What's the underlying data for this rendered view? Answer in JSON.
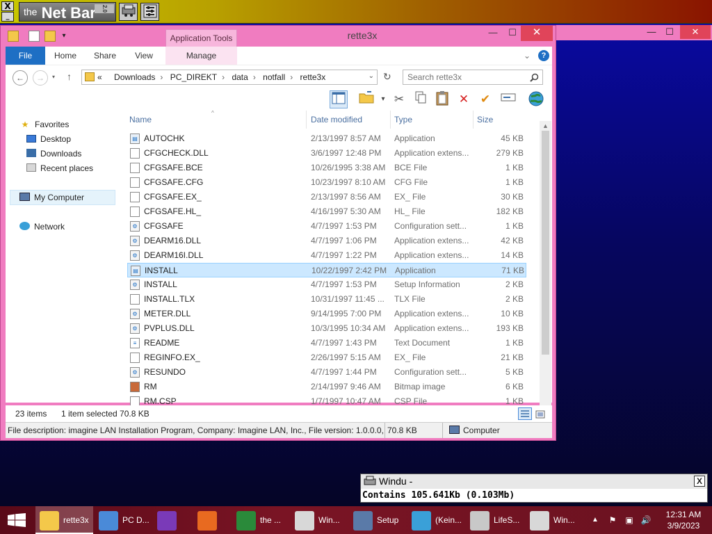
{
  "netbar": {
    "close_glyph": "X",
    "underscore_glyph": "_",
    "logo_prefix": "the",
    "logo_text": "Net Bar",
    "logo_version": "2.0",
    "apps": [
      "network-app-icon",
      "settings-app-icon"
    ]
  },
  "window": {
    "title": "rette3x",
    "context_tab": "Application Tools",
    "controls": {
      "minimize": "—",
      "maximize": "☐",
      "close": "✕"
    }
  },
  "ribbon": {
    "tabs": {
      "file": "File",
      "home": "Home",
      "share": "Share",
      "view": "View",
      "manage": "Manage"
    },
    "expand_glyph": "⌄",
    "help_glyph": "?"
  },
  "address": {
    "overflow": "«",
    "crumbs": [
      "Downloads",
      "PC_DIREKT",
      "data",
      "notfall",
      "rette3x"
    ],
    "search_placeholder": "Search rette3x"
  },
  "navpane": {
    "favorites": "Favorites",
    "desktop": "Desktop",
    "downloads": "Downloads",
    "recent": "Recent places",
    "mycomputer": "My Computer",
    "network": "Network"
  },
  "columns": {
    "name": "Name",
    "date": "Date modified",
    "type": "Type",
    "size": "Size"
  },
  "files": [
    {
      "name": "AUTOCHK",
      "date": "2/13/1997 8:57 AM",
      "type": "Application",
      "size": "45 KB",
      "icon": "app"
    },
    {
      "name": "CFGCHECK.DLL",
      "date": "3/6/1997 12:48 PM",
      "type": "Application extens...",
      "size": "279 KB",
      "icon": "file"
    },
    {
      "name": "CFGSAFE.BCE",
      "date": "10/26/1995 3:38 AM",
      "type": "BCE File",
      "size": "1 KB",
      "icon": "file"
    },
    {
      "name": "CFGSAFE.CFG",
      "date": "10/23/1997 8:10 AM",
      "type": "CFG File",
      "size": "1 KB",
      "icon": "file"
    },
    {
      "name": "CFGSAFE.EX_",
      "date": "2/13/1997 8:56 AM",
      "type": "EX_ File",
      "size": "30 KB",
      "icon": "file"
    },
    {
      "name": "CFGSAFE.HL_",
      "date": "4/16/1997 5:30 AM",
      "type": "HL_ File",
      "size": "182 KB",
      "icon": "file"
    },
    {
      "name": "CFGSAFE",
      "date": "4/7/1997 1:53 PM",
      "type": "Configuration sett...",
      "size": "1 KB",
      "icon": "gear"
    },
    {
      "name": "DEARM16.DLL",
      "date": "4/7/1997 1:06 PM",
      "type": "Application extens...",
      "size": "42 KB",
      "icon": "gear"
    },
    {
      "name": "DEARM16I.DLL",
      "date": "4/7/1997 1:22 PM",
      "type": "Application extens...",
      "size": "14 KB",
      "icon": "gear"
    },
    {
      "name": "INSTALL",
      "date": "10/22/1997 2:42 PM",
      "type": "Application",
      "size": "71 KB",
      "icon": "app"
    },
    {
      "name": "INSTALL",
      "date": "4/7/1997 1:53 PM",
      "type": "Setup Information",
      "size": "2 KB",
      "icon": "gear"
    },
    {
      "name": "INSTALL.TLX",
      "date": "10/31/1997 11:45 ...",
      "type": "TLX File",
      "size": "2 KB",
      "icon": "file"
    },
    {
      "name": "METER.DLL",
      "date": "9/14/1995 7:00 PM",
      "type": "Application extens...",
      "size": "10 KB",
      "icon": "gear"
    },
    {
      "name": "PVPLUS.DLL",
      "date": "10/3/1995 10:34 AM",
      "type": "Application extens...",
      "size": "193 KB",
      "icon": "gear"
    },
    {
      "name": "README",
      "date": "4/7/1997 1:43 PM",
      "type": "Text Document",
      "size": "1 KB",
      "icon": "text"
    },
    {
      "name": "REGINFO.EX_",
      "date": "2/26/1997 5:15 AM",
      "type": "EX_ File",
      "size": "21 KB",
      "icon": "file"
    },
    {
      "name": "RESUNDO",
      "date": "4/7/1997 1:44 PM",
      "type": "Configuration sett...",
      "size": "5 KB",
      "icon": "gear"
    },
    {
      "name": "RM",
      "date": "2/14/1997 9:46 AM",
      "type": "Bitmap image",
      "size": "6 KB",
      "icon": "bitmap"
    },
    {
      "name": "RM.CSP",
      "date": "1/7/1997 10:47 AM",
      "type": "CSP File",
      "size": "1 KB",
      "icon": "file"
    }
  ],
  "selected_index": 9,
  "status": {
    "count": "23 items",
    "selection": "1 item selected  70.8 KB",
    "description": "File description: imagine LAN Installation Program, Company: Imagine LAN, Inc., File version: 1.0.0.0, D",
    "size": "70.8 KB",
    "location": "Computer"
  },
  "popup": {
    "title": "Windu -",
    "body": "Contains 105.641Kb (0.103Mb)",
    "close_glyph": "X"
  },
  "taskbar": {
    "items": [
      {
        "label": "rette3x",
        "icon": "folder-icon"
      },
      {
        "label": "PC D...",
        "icon": "chrome-icon"
      },
      {
        "label": "",
        "icon": "visual-studio-icon"
      },
      {
        "label": "",
        "icon": "firefox-icon"
      },
      {
        "label": "the ...",
        "icon": "netbar-icon"
      },
      {
        "label": "Win...",
        "icon": "help-icon"
      },
      {
        "label": "Setup",
        "icon": "setup-icon"
      },
      {
        "label": "(Kein...",
        "icon": "globe-icon"
      },
      {
        "label": "LifeS...",
        "icon": "lifesaver-icon"
      },
      {
        "label": "Win...",
        "icon": "window-icon"
      }
    ],
    "time": "12:31 AM",
    "date": "3/9/2023"
  }
}
